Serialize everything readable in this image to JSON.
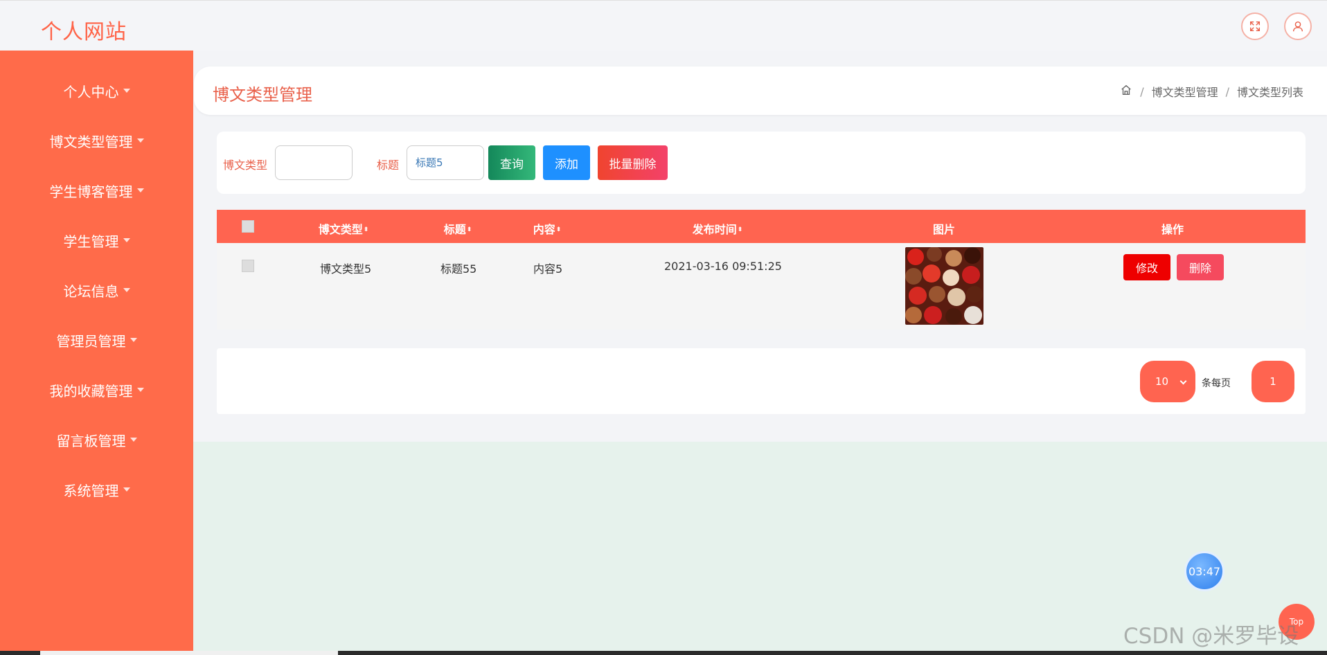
{
  "header": {
    "site_title": "个人网站",
    "icons": [
      "fullscreen-icon",
      "user-icon"
    ]
  },
  "sidebar": {
    "items": [
      {
        "label": "个人中心"
      },
      {
        "label": "博文类型管理"
      },
      {
        "label": "学生博客管理"
      },
      {
        "label": "学生管理"
      },
      {
        "label": "论坛信息"
      },
      {
        "label": "管理员管理"
      },
      {
        "label": "我的收藏管理"
      },
      {
        "label": "留言板管理"
      },
      {
        "label": "系统管理"
      }
    ]
  },
  "page": {
    "title": "博文类型管理",
    "breadcrumb": [
      "博文类型管理",
      "博文类型列表"
    ]
  },
  "search": {
    "type_label": "博文类型",
    "type_value": "",
    "title_label": "标题",
    "title_value": "标题5",
    "query_btn": "查询",
    "add_btn": "添加",
    "batch_delete_btn": "批量删除"
  },
  "table": {
    "columns": [
      "博文类型",
      "标题",
      "内容",
      "发布时间",
      "图片",
      "操作"
    ],
    "rows": [
      {
        "type": "博文类型5",
        "title": "标题55",
        "content": "内容5",
        "time": "2021-03-16 09:51:25",
        "image": "chocolates",
        "edit": "修改",
        "delete": "删除"
      }
    ]
  },
  "pagination": {
    "page_size": "10",
    "per_page_label": "条每页",
    "current_page": "1"
  },
  "floating": {
    "timer": "03:47",
    "top_label": "Top",
    "watermark": "CSDN @米罗毕设"
  },
  "colors": {
    "accent": "#ff6450",
    "sidebar": "#ff6b4a",
    "query": "#1a9e6a",
    "add": "#1e90ff",
    "batch_delete": "#f04050",
    "edit": "#ee0000",
    "delete": "#f54a5e"
  }
}
